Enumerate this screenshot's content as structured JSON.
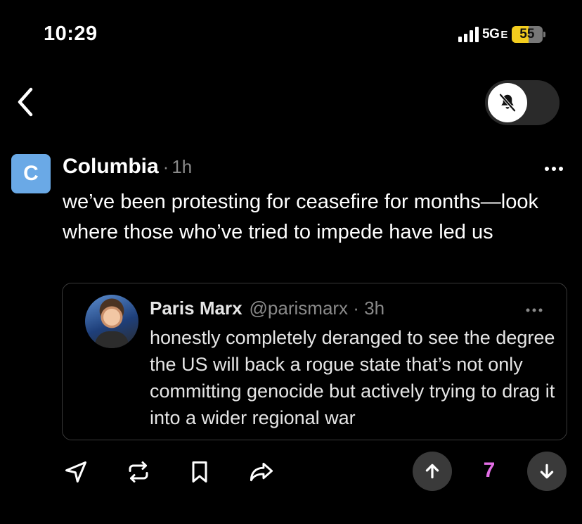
{
  "status_bar": {
    "time": "10:29",
    "network": "5G",
    "network_suffix": "E",
    "battery": "55",
    "battery_level": 0.55,
    "battery_color": "#f3cd1e"
  },
  "header": {
    "back_icon": "chevron-left-icon",
    "mute_icon": "bell-slash-icon"
  },
  "post": {
    "avatar_letter": "C",
    "avatar_color": "#6aa9e6",
    "author": "Columbia",
    "separator": "·",
    "time": "1h",
    "text": "we’ve been protesting for ceasefire for months—look where those who’ve tried to impede have led us",
    "more_icon": "ellipsis-icon"
  },
  "quote": {
    "name": "Paris Marx",
    "handle": "@parismarx · 3h",
    "text": "honestly completely deranged to see the degree the US will back a rogue state that’s not only committing genocide but actively trying to drag it into a wider regional war"
  },
  "actions": {
    "reply_icon": "send-icon",
    "repost_icon": "repost-icon",
    "bookmark_icon": "bookmark-icon",
    "share_icon": "share-arrow-icon",
    "upvote_icon": "arrow-up-icon",
    "downvote_icon": "arrow-down-icon",
    "score": "7",
    "score_color": "#e36ee6"
  }
}
